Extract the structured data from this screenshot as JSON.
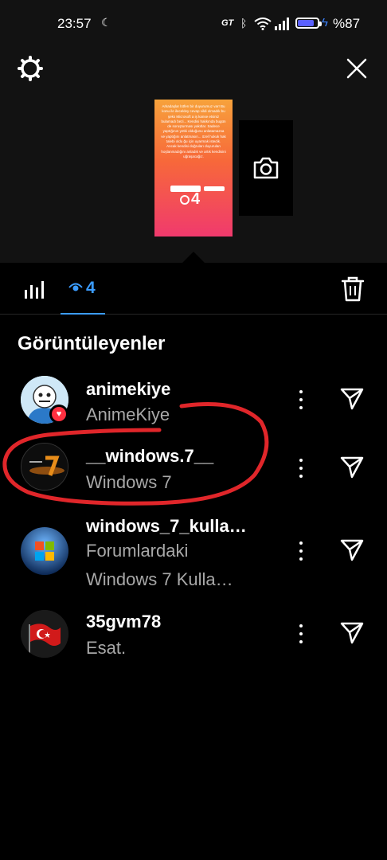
{
  "status_bar": {
    "time": "23:57",
    "gt_label": "GT",
    "battery_text": "%87",
    "icons": [
      "moon-icon",
      "bluetooth-icon",
      "wifi-icon",
      "signal-icon",
      "battery-icon",
      "charging-bolt-icon"
    ]
  },
  "story_preview": {
    "text": "Arkadaşlar lütfen bir duyurumuz var! Bu konu ile ilecekley cevap vildi olmadık bu şeks Microsoft a iş kanse etsiniz bulamadı bezi... Kendisi hakkında bugün de soruşturması yakıtlar. Sadece yaptığının yetki olduğunu anlatamazsa ve yaptığını anlatmasın... özel hukuk hak talebi oldu ğu için uyarmak istedik. Ancak kendisi doğruları duyurulan hoşlanmadığını anladık ve artık kendisini uğraşacağız.",
    "views_count": "4",
    "colors": {
      "top": "#f7a23b",
      "bottom": "#f03a6d"
    }
  },
  "tabs": {
    "viewers_count": "4",
    "active_color": "#3b9cff"
  },
  "section_title": "Görüntüleyenler",
  "viewers": [
    {
      "username": "animekiye",
      "full_name": "AnimeKiye",
      "liked": true
    },
    {
      "username": "__windows.7__",
      "full_name": "Windows 7",
      "liked": false
    },
    {
      "username": "windows_7_kulla…",
      "full_name_line1": "Forumlardaki",
      "full_name_line2": "Windows 7 Kulla…",
      "liked": false
    },
    {
      "username": "35gvm78",
      "full_name": "Esat.",
      "liked": false
    }
  ],
  "annotation": {
    "color": "#e0262a",
    "description": "hand-drawn red circle around the second viewer"
  }
}
